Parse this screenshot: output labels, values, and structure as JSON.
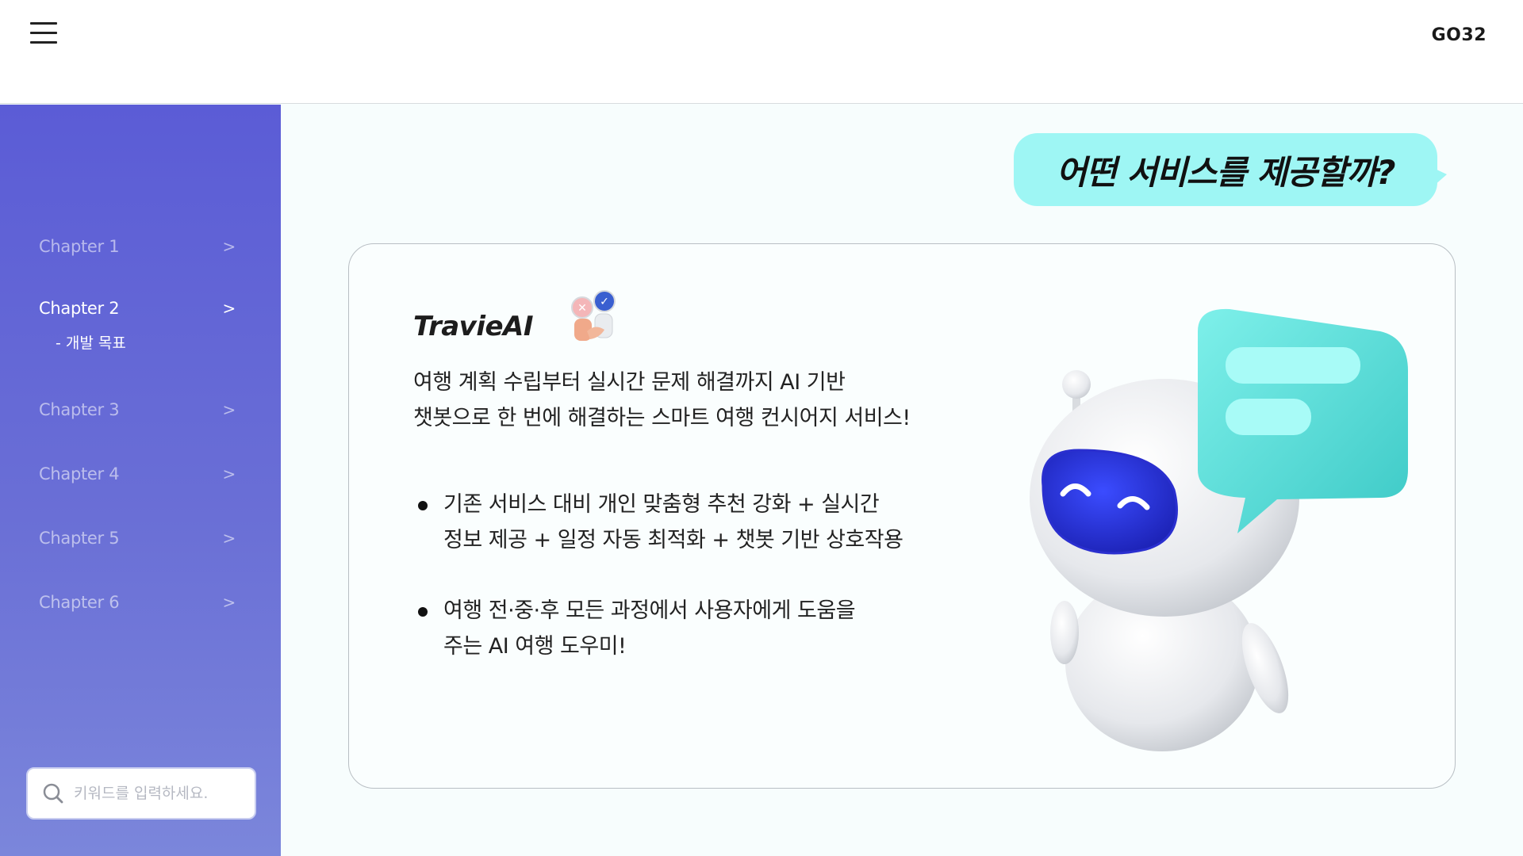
{
  "header": {
    "brand": "GO32",
    "menu_icon": "hamburger-menu-icon"
  },
  "sidebar": {
    "items": [
      {
        "label": "Chapter 1",
        "chevron": ">"
      },
      {
        "label": "Chapter 2",
        "chevron": ">",
        "active": true
      },
      {
        "label": "Chapter 3",
        "chevron": ">"
      },
      {
        "label": "Chapter 4",
        "chevron": ">"
      },
      {
        "label": "Chapter 5",
        "chevron": ">"
      },
      {
        "label": "Chapter 6",
        "chevron": ">"
      }
    ],
    "sub_item": "- 개발 목표",
    "search": {
      "placeholder": "키워드를 입력하세요.",
      "icon": "search-icon"
    },
    "colors": {
      "gradient_top": "#5b5cd6",
      "gradient_bottom": "#7b86db"
    }
  },
  "main": {
    "bubble_title": "어떤 서비스를 제공할까?",
    "card": {
      "title": "TravieAI",
      "title_icon": "handshake-icon",
      "description": [
        "여행 계획 수립부터 실시간 문제 해결까지 AI 기반",
        "챗봇으로 한 번에 해결하는 스마트 여행 컨시어지 서비스!"
      ],
      "bullets": [
        [
          "기존 서비스 대비 개인 맞춤형 추천 강화 + 실시간",
          "정보 제공 + 일정 자동 최적화 + 챗봇 기반 상호작용"
        ],
        [
          "여행 전·중·후 모든 과정에서 사용자에게 도움을",
          "주는 AI 여행 도우미!"
        ]
      ],
      "illustration": "robot-chatbot-illustration"
    },
    "colors": {
      "bubble": "#9ef6f4",
      "card_border": "#b9bfc4"
    }
  }
}
